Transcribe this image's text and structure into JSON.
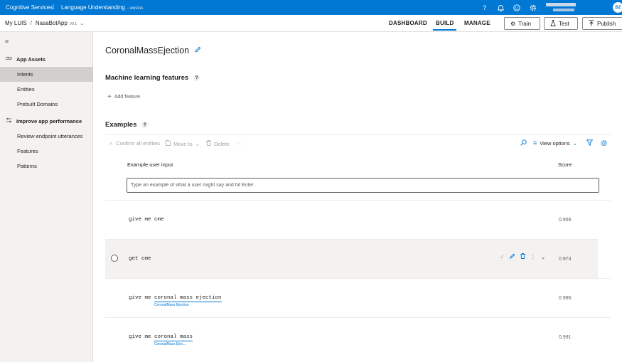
{
  "topbar": {
    "brand": "Cognitive Services",
    "separator": "|",
    "app_title": "Language Understanding",
    "region": "- westus",
    "icons": [
      "help-icon",
      "bell-icon",
      "smiley-icon",
      "gear-icon"
    ],
    "avatar_initials": "BZ"
  },
  "nav": {
    "my_luis": "My LUIS",
    "breadcrumb_sep": "/",
    "app_name": "NasaBotApp",
    "version": "V0.1",
    "tabs": [
      "DASHBOARD",
      "BUILD",
      "MANAGE"
    ],
    "active_tab": "BUILD",
    "train_label": "Train",
    "test_label": "Test",
    "publish_label": "Publish"
  },
  "sidebar": {
    "app_assets_label": "App Assets",
    "improve_label": "Improve app performance",
    "items": [
      "Intents",
      "Entities",
      "Prebuilt Domains"
    ],
    "improve_items": [
      "Review endpoint utterances",
      "Features",
      "Patterns"
    ],
    "selected": "Intents"
  },
  "main": {
    "intent_name": "CoronalMassEjection",
    "ml_features_heading": "Machine learning features",
    "add_feature_label": "Add feature",
    "examples_heading": "Examples",
    "help_glyph": "?",
    "toolbar": {
      "confirm_all": "Confirm all entities",
      "move_to": "Move to",
      "delete": "Delete",
      "more": "···",
      "view_options": "View options"
    },
    "columns": {
      "input": "Example user input",
      "score": "Score"
    },
    "input_placeholder": "Type an example of what a user might say and hit Enter.",
    "examples": [
      {
        "text": "give me cme",
        "score": "0.956"
      },
      {
        "text": "get cme",
        "score": "0.974"
      },
      {
        "prefix": "give me ",
        "entity_text": "coronal mass ejection",
        "entity_label": "CoronalMass Ejection",
        "score": "0.996"
      },
      {
        "prefix": "give me ",
        "entity_text": "coronal mass",
        "entity_label": "CoronalMass Ejec...",
        "score": "0.991"
      }
    ]
  },
  "colors": {
    "accent": "#0078d4",
    "selected_nav": "#d2d0ce",
    "sidebar_bg": "#f3f2f1"
  }
}
